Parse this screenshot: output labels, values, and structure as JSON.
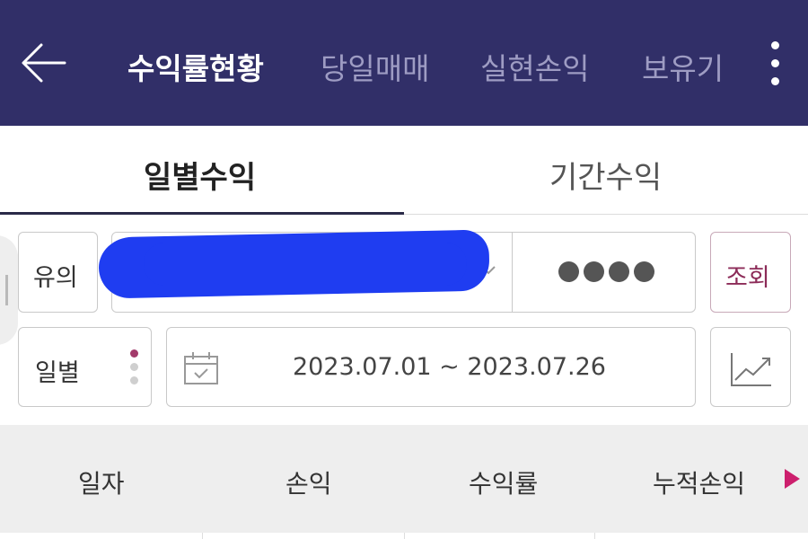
{
  "header": {
    "tabs": [
      {
        "label": "수익률현황",
        "active": true
      },
      {
        "label": "당일매매",
        "active": false
      },
      {
        "label": "실현손익",
        "active": false
      },
      {
        "label": "보유기",
        "active": false
      }
    ],
    "back_icon": "back-arrow-icon",
    "more_icon": "more-vertical-icon"
  },
  "subtabs": [
    {
      "label": "일별수익",
      "active": true
    },
    {
      "label": "기간수익",
      "active": false
    }
  ],
  "account": {
    "type_label": "유의",
    "password_mask": "●●●●",
    "search_label": "조회"
  },
  "period": {
    "mode_label": "일별",
    "date_range": "2023.07.01 ~ 2023.07.26",
    "calendar_icon": "calendar-icon",
    "chart_icon": "line-chart-icon"
  },
  "table": {
    "columns": [
      "일자",
      "손익",
      "수익률",
      "누적손익"
    ]
  },
  "colors": {
    "header_bg": "#312f68",
    "accent": "#cc1f6d",
    "search_text": "#8c2b58"
  }
}
